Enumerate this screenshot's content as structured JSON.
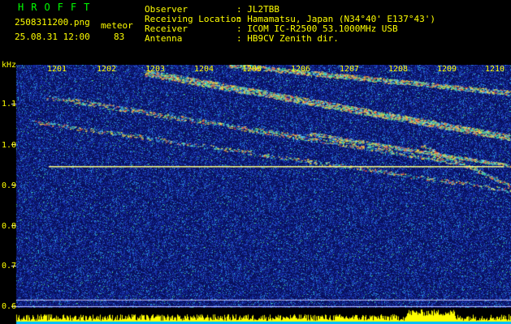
{
  "header": {
    "brand": "HROFFT",
    "filename": "2508311200.png",
    "datetime": "25.08.31 12:00",
    "mode_label": "meteor",
    "count": "83",
    "fields": [
      {
        "label": "Observer",
        "value": ": JL2TBB"
      },
      {
        "label": "Receiving Location",
        "value": ": Hamamatsu, Japan (N34°40' E137°43')"
      },
      {
        "label": "Receiver",
        "value": ": ICOM IC-R2500 53.1000MHz USB"
      },
      {
        "label": "Antenna",
        "value": ": HB9CV Zenith dir."
      }
    ]
  },
  "axis": {
    "y_unit": "kHz",
    "y_ticks": [
      "1.1",
      "1.0",
      "0.9",
      "0.8",
      "0.7",
      "0.6"
    ],
    "x_ticks": [
      "1201",
      "1202",
      "1203",
      "1204",
      "1205",
      "1206",
      "1207",
      "1208",
      "1209",
      "1210"
    ]
  },
  "colors": {
    "background": "#000000",
    "text": "#ffff00",
    "plot_noise": "#1a2a9a",
    "grid": "#a0a0ff",
    "signal": "#ffff66"
  }
}
